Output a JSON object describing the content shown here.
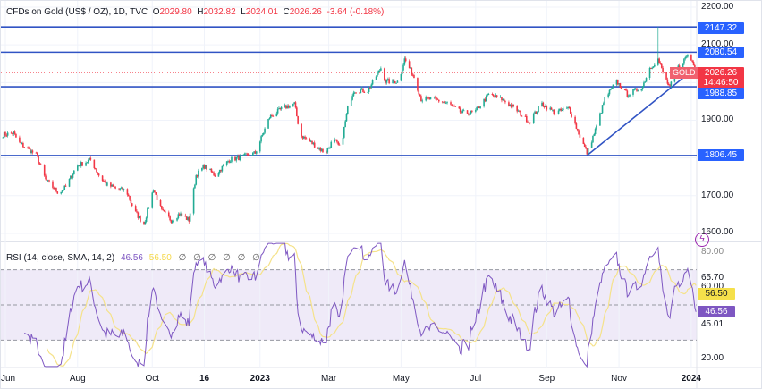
{
  "header": {
    "symbol": "CFDs on Gold (US$ / OZ), 1D, TVC",
    "open_label": "O",
    "open": "2029.80",
    "high_label": "H",
    "high": "2032.82",
    "low_label": "L",
    "low": "2024.01",
    "close_label": "C",
    "close": "2026.26",
    "change": "-3.64 (-0.18%)"
  },
  "price_axis": {
    "ticks": [
      "2200.00",
      "2100.00",
      "1900.00",
      "1700.00",
      "1600.00"
    ],
    "levels": [
      {
        "label": "2147.32",
        "value": 2147.32
      },
      {
        "label": "2080.54",
        "value": 2080.54
      },
      {
        "label": "1988.85",
        "value": 1988.85
      },
      {
        "label": "1806.45",
        "value": 1806.45
      }
    ],
    "current": {
      "symbol": "GOLD",
      "price": "2026.26",
      "countdown": "14:46:50"
    }
  },
  "rsi": {
    "legend": "RSI (14, close, SMA, 14, 2)",
    "value": "46.56",
    "ma_value": "56.50",
    "extras": [
      "∅",
      "∅",
      "∅",
      "∅",
      "∅",
      "∅"
    ],
    "ticks": [
      "80.00",
      "65.70",
      "60.00",
      "45.01",
      "20.00"
    ],
    "upper_band": 70,
    "middle_band": 50,
    "lower_band": 30
  },
  "time_axis": {
    "ticks": [
      {
        "label": "Jun",
        "date": "2022-06-01",
        "bold": false
      },
      {
        "label": "Aug",
        "date": "2022-08-01",
        "bold": false
      },
      {
        "label": "Oct",
        "date": "2022-10-03",
        "bold": false
      },
      {
        "label": "16",
        "date": "2022-11-16",
        "bold": true
      },
      {
        "label": "2023",
        "date": "2023-01-02",
        "bold": true
      },
      {
        "label": "Mar",
        "date": "2023-03-01",
        "bold": false
      },
      {
        "label": "May",
        "date": "2023-05-01",
        "bold": false
      },
      {
        "label": "Jul",
        "date": "2023-07-03",
        "bold": false
      },
      {
        "label": "Sep",
        "date": "2023-09-01",
        "bold": false
      },
      {
        "label": "Nov",
        "date": "2023-11-01",
        "bold": false
      },
      {
        "label": "2024",
        "date": "2024-01-01",
        "bold": true
      }
    ]
  },
  "colors": {
    "up": "#22ab94",
    "down": "#f23645",
    "level_line": "#3154c4",
    "level_tag": "#2962ff",
    "rsi_line": "#7e57c2",
    "rsi_ma": "#f5e28a",
    "rsi_band": "#efeaf8"
  },
  "icons": {
    "alert": "lightning-icon"
  },
  "chart_data": {
    "type": "candlestick",
    "title": "CFDs on Gold (US$ / OZ), 1D, TVC",
    "ylim": [
      1580,
      2215
    ],
    "xlim": [
      "2022-05-28",
      "2024-01-10"
    ],
    "grid": true,
    "close_approx": [
      [
        "2022-05-28",
        1861
      ],
      [
        "2022-06-08",
        1866
      ],
      [
        "2022-06-12",
        1842
      ],
      [
        "2022-06-27",
        1808
      ],
      [
        "2022-07-05",
        1742
      ],
      [
        "2022-07-16",
        1707
      ],
      [
        "2022-07-22",
        1723
      ],
      [
        "2022-07-31",
        1778
      ],
      [
        "2022-08-12",
        1795
      ],
      [
        "2022-08-19",
        1754
      ],
      [
        "2022-08-25",
        1730
      ],
      [
        "2022-09-03",
        1718
      ],
      [
        "2022-09-11",
        1714
      ],
      [
        "2022-09-18",
        1659
      ],
      [
        "2022-09-26",
        1624
      ],
      [
        "2022-10-04",
        1718
      ],
      [
        "2022-10-11",
        1659
      ],
      [
        "2022-10-19",
        1635
      ],
      [
        "2022-10-26",
        1652
      ],
      [
        "2022-11-03",
        1635
      ],
      [
        "2022-11-09",
        1754
      ],
      [
        "2022-11-16",
        1778
      ],
      [
        "2022-11-25",
        1754
      ],
      [
        "2022-12-07",
        1795
      ],
      [
        "2022-12-17",
        1802
      ],
      [
        "2022-12-29",
        1813
      ],
      [
        "2023-01-10",
        1908
      ],
      [
        "2023-01-21",
        1932
      ],
      [
        "2023-01-31",
        1944
      ],
      [
        "2023-02-05",
        1861
      ],
      [
        "2023-02-16",
        1837
      ],
      [
        "2023-02-26",
        1813
      ],
      [
        "2023-03-05",
        1849
      ],
      [
        "2023-03-11",
        1825
      ],
      [
        "2023-03-17",
        1932
      ],
      [
        "2023-03-22",
        1979
      ],
      [
        "2023-04-03",
        1979
      ],
      [
        "2023-04-14",
        2039
      ],
      [
        "2023-04-18",
        2003
      ],
      [
        "2023-04-29",
        2003
      ],
      [
        "2023-05-04",
        2062
      ],
      [
        "2023-05-12",
        2015
      ],
      [
        "2023-05-18",
        1956
      ],
      [
        "2023-05-29",
        1956
      ],
      [
        "2023-06-10",
        1944
      ],
      [
        "2023-06-21",
        1920
      ],
      [
        "2023-07-02",
        1920
      ],
      [
        "2023-07-14",
        1968
      ],
      [
        "2023-07-25",
        1956
      ],
      [
        "2023-08-05",
        1932
      ],
      [
        "2023-08-17",
        1896
      ],
      [
        "2023-08-28",
        1944
      ],
      [
        "2023-09-08",
        1920
      ],
      [
        "2023-09-20",
        1932
      ],
      [
        "2023-09-27",
        1873
      ],
      [
        "2023-10-05",
        1813
      ],
      [
        "2023-10-12",
        1873
      ],
      [
        "2023-10-20",
        1956
      ],
      [
        "2023-10-30",
        2003
      ],
      [
        "2023-11-08",
        1968
      ],
      [
        "2023-11-15",
        1979
      ],
      [
        "2023-11-21",
        1991
      ],
      [
        "2023-11-27",
        2039
      ],
      [
        "2023-12-04",
        2062
      ],
      [
        "2023-12-08",
        2027
      ],
      [
        "2023-12-14",
        1984
      ],
      [
        "2023-12-17",
        2027
      ],
      [
        "2023-12-24",
        2051
      ],
      [
        "2023-12-29",
        2074
      ],
      [
        "2024-01-03",
        2051
      ],
      [
        "2024-01-05",
        2026.26
      ]
    ],
    "spike_high": {
      "date": "2023-12-04",
      "value": 2147.32
    },
    "trendline": [
      [
        "2023-10-05",
        1806.45
      ],
      [
        "2024-01-05",
        2040
      ]
    ]
  }
}
